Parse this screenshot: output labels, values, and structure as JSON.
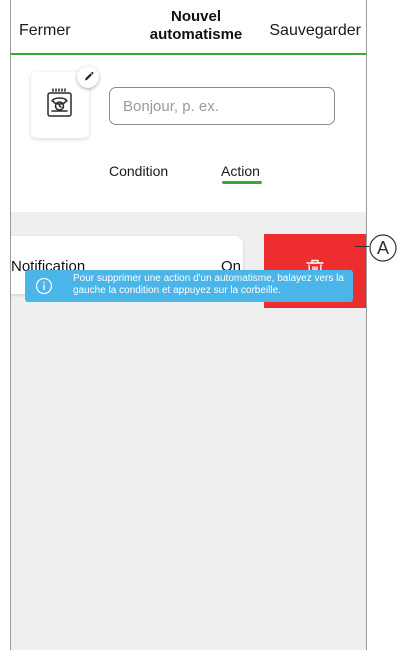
{
  "header": {
    "close_label": "Fermer",
    "title_line1": "Nouvel",
    "title_line2": "automatisme",
    "save_label": "Sauvegarder"
  },
  "automation": {
    "icon": "automation-icon",
    "edit_icon": "pencil-icon",
    "name_value": "",
    "name_placeholder": "Bonjour, p. ex."
  },
  "tabs": [
    {
      "label": "Condition",
      "active": false
    },
    {
      "label": "Action",
      "active": true
    }
  ],
  "actions": [
    {
      "label": "Notification",
      "value": "On"
    }
  ],
  "delete_action": {
    "icon": "trash-icon"
  },
  "info_banner": {
    "icon": "info-icon",
    "text": "Pour supprimer une action d'un automatisme, balayez vers la gauche la condition et appuyez sur la corbeille."
  },
  "callout": {
    "label": "A"
  },
  "colors": {
    "accent_green": "#3aaa35",
    "delete_red": "#ee2e2e",
    "info_blue": "#4ab5e8",
    "background_gray": "#efefef"
  }
}
